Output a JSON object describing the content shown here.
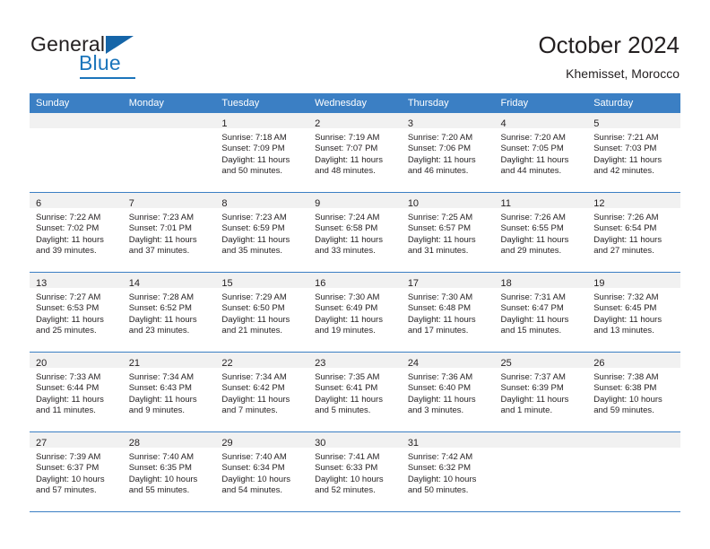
{
  "brand": {
    "name_part1": "General",
    "name_part2": "Blue"
  },
  "header": {
    "title": "October 2024",
    "subtitle": "Khemisset, Morocco"
  },
  "colors": {
    "header_blue": "#3b7fc4",
    "brand_blue": "#1b75bb",
    "daynum_band": "#f1f1f1",
    "text": "#231f20"
  },
  "weekday_headers": [
    "Sunday",
    "Monday",
    "Tuesday",
    "Wednesday",
    "Thursday",
    "Friday",
    "Saturday"
  ],
  "labels": {
    "sunrise_prefix": "Sunrise:",
    "sunset_prefix": "Sunset:",
    "daylight_prefix": "Daylight:"
  },
  "weeks": [
    [
      {
        "day": "",
        "sunrise": "",
        "sunset": "",
        "daylight_line1": "",
        "daylight_line2": ""
      },
      {
        "day": "",
        "sunrise": "",
        "sunset": "",
        "daylight_line1": "",
        "daylight_line2": ""
      },
      {
        "day": "1",
        "sunrise": "Sunrise: 7:18 AM",
        "sunset": "Sunset: 7:09 PM",
        "daylight_line1": "Daylight: 11 hours",
        "daylight_line2": "and 50 minutes."
      },
      {
        "day": "2",
        "sunrise": "Sunrise: 7:19 AM",
        "sunset": "Sunset: 7:07 PM",
        "daylight_line1": "Daylight: 11 hours",
        "daylight_line2": "and 48 minutes."
      },
      {
        "day": "3",
        "sunrise": "Sunrise: 7:20 AM",
        "sunset": "Sunset: 7:06 PM",
        "daylight_line1": "Daylight: 11 hours",
        "daylight_line2": "and 46 minutes."
      },
      {
        "day": "4",
        "sunrise": "Sunrise: 7:20 AM",
        "sunset": "Sunset: 7:05 PM",
        "daylight_line1": "Daylight: 11 hours",
        "daylight_line2": "and 44 minutes."
      },
      {
        "day": "5",
        "sunrise": "Sunrise: 7:21 AM",
        "sunset": "Sunset: 7:03 PM",
        "daylight_line1": "Daylight: 11 hours",
        "daylight_line2": "and 42 minutes."
      }
    ],
    [
      {
        "day": "6",
        "sunrise": "Sunrise: 7:22 AM",
        "sunset": "Sunset: 7:02 PM",
        "daylight_line1": "Daylight: 11 hours",
        "daylight_line2": "and 39 minutes."
      },
      {
        "day": "7",
        "sunrise": "Sunrise: 7:23 AM",
        "sunset": "Sunset: 7:01 PM",
        "daylight_line1": "Daylight: 11 hours",
        "daylight_line2": "and 37 minutes."
      },
      {
        "day": "8",
        "sunrise": "Sunrise: 7:23 AM",
        "sunset": "Sunset: 6:59 PM",
        "daylight_line1": "Daylight: 11 hours",
        "daylight_line2": "and 35 minutes."
      },
      {
        "day": "9",
        "sunrise": "Sunrise: 7:24 AM",
        "sunset": "Sunset: 6:58 PM",
        "daylight_line1": "Daylight: 11 hours",
        "daylight_line2": "and 33 minutes."
      },
      {
        "day": "10",
        "sunrise": "Sunrise: 7:25 AM",
        "sunset": "Sunset: 6:57 PM",
        "daylight_line1": "Daylight: 11 hours",
        "daylight_line2": "and 31 minutes."
      },
      {
        "day": "11",
        "sunrise": "Sunrise: 7:26 AM",
        "sunset": "Sunset: 6:55 PM",
        "daylight_line1": "Daylight: 11 hours",
        "daylight_line2": "and 29 minutes."
      },
      {
        "day": "12",
        "sunrise": "Sunrise: 7:26 AM",
        "sunset": "Sunset: 6:54 PM",
        "daylight_line1": "Daylight: 11 hours",
        "daylight_line2": "and 27 minutes."
      }
    ],
    [
      {
        "day": "13",
        "sunrise": "Sunrise: 7:27 AM",
        "sunset": "Sunset: 6:53 PM",
        "daylight_line1": "Daylight: 11 hours",
        "daylight_line2": "and 25 minutes."
      },
      {
        "day": "14",
        "sunrise": "Sunrise: 7:28 AM",
        "sunset": "Sunset: 6:52 PM",
        "daylight_line1": "Daylight: 11 hours",
        "daylight_line2": "and 23 minutes."
      },
      {
        "day": "15",
        "sunrise": "Sunrise: 7:29 AM",
        "sunset": "Sunset: 6:50 PM",
        "daylight_line1": "Daylight: 11 hours",
        "daylight_line2": "and 21 minutes."
      },
      {
        "day": "16",
        "sunrise": "Sunrise: 7:30 AM",
        "sunset": "Sunset: 6:49 PM",
        "daylight_line1": "Daylight: 11 hours",
        "daylight_line2": "and 19 minutes."
      },
      {
        "day": "17",
        "sunrise": "Sunrise: 7:30 AM",
        "sunset": "Sunset: 6:48 PM",
        "daylight_line1": "Daylight: 11 hours",
        "daylight_line2": "and 17 minutes."
      },
      {
        "day": "18",
        "sunrise": "Sunrise: 7:31 AM",
        "sunset": "Sunset: 6:47 PM",
        "daylight_line1": "Daylight: 11 hours",
        "daylight_line2": "and 15 minutes."
      },
      {
        "day": "19",
        "sunrise": "Sunrise: 7:32 AM",
        "sunset": "Sunset: 6:45 PM",
        "daylight_line1": "Daylight: 11 hours",
        "daylight_line2": "and 13 minutes."
      }
    ],
    [
      {
        "day": "20",
        "sunrise": "Sunrise: 7:33 AM",
        "sunset": "Sunset: 6:44 PM",
        "daylight_line1": "Daylight: 11 hours",
        "daylight_line2": "and 11 minutes."
      },
      {
        "day": "21",
        "sunrise": "Sunrise: 7:34 AM",
        "sunset": "Sunset: 6:43 PM",
        "daylight_line1": "Daylight: 11 hours",
        "daylight_line2": "and 9 minutes."
      },
      {
        "day": "22",
        "sunrise": "Sunrise: 7:34 AM",
        "sunset": "Sunset: 6:42 PM",
        "daylight_line1": "Daylight: 11 hours",
        "daylight_line2": "and 7 minutes."
      },
      {
        "day": "23",
        "sunrise": "Sunrise: 7:35 AM",
        "sunset": "Sunset: 6:41 PM",
        "daylight_line1": "Daylight: 11 hours",
        "daylight_line2": "and 5 minutes."
      },
      {
        "day": "24",
        "sunrise": "Sunrise: 7:36 AM",
        "sunset": "Sunset: 6:40 PM",
        "daylight_line1": "Daylight: 11 hours",
        "daylight_line2": "and 3 minutes."
      },
      {
        "day": "25",
        "sunrise": "Sunrise: 7:37 AM",
        "sunset": "Sunset: 6:39 PM",
        "daylight_line1": "Daylight: 11 hours",
        "daylight_line2": "and 1 minute."
      },
      {
        "day": "26",
        "sunrise": "Sunrise: 7:38 AM",
        "sunset": "Sunset: 6:38 PM",
        "daylight_line1": "Daylight: 10 hours",
        "daylight_line2": "and 59 minutes."
      }
    ],
    [
      {
        "day": "27",
        "sunrise": "Sunrise: 7:39 AM",
        "sunset": "Sunset: 6:37 PM",
        "daylight_line1": "Daylight: 10 hours",
        "daylight_line2": "and 57 minutes."
      },
      {
        "day": "28",
        "sunrise": "Sunrise: 7:40 AM",
        "sunset": "Sunset: 6:35 PM",
        "daylight_line1": "Daylight: 10 hours",
        "daylight_line2": "and 55 minutes."
      },
      {
        "day": "29",
        "sunrise": "Sunrise: 7:40 AM",
        "sunset": "Sunset: 6:34 PM",
        "daylight_line1": "Daylight: 10 hours",
        "daylight_line2": "and 54 minutes."
      },
      {
        "day": "30",
        "sunrise": "Sunrise: 7:41 AM",
        "sunset": "Sunset: 6:33 PM",
        "daylight_line1": "Daylight: 10 hours",
        "daylight_line2": "and 52 minutes."
      },
      {
        "day": "31",
        "sunrise": "Sunrise: 7:42 AM",
        "sunset": "Sunset: 6:32 PM",
        "daylight_line1": "Daylight: 10 hours",
        "daylight_line2": "and 50 minutes."
      },
      {
        "day": "",
        "sunrise": "",
        "sunset": "",
        "daylight_line1": "",
        "daylight_line2": ""
      },
      {
        "day": "",
        "sunrise": "",
        "sunset": "",
        "daylight_line1": "",
        "daylight_line2": ""
      }
    ]
  ]
}
